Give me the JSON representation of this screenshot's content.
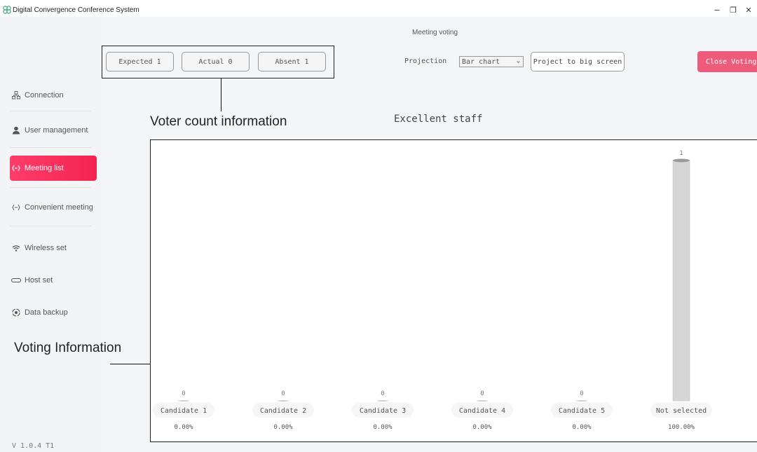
{
  "window": {
    "title": "Digital Convergence Conference System",
    "minimize": "–",
    "maximize": "❐",
    "close": "✕"
  },
  "sidebar": {
    "items": [
      {
        "label": "Connection",
        "icon": "connection-icon",
        "active": false
      },
      {
        "label": "User management",
        "icon": "user-icon",
        "active": false
      },
      {
        "label": "Meeting list",
        "icon": "meeting-list-icon",
        "active": true
      },
      {
        "label": "Convenient meeting",
        "icon": "convenient-meeting-icon",
        "active": false
      },
      {
        "label": "Wireless set",
        "icon": "wifi-icon",
        "active": false
      },
      {
        "label": "Host set",
        "icon": "host-icon",
        "active": false
      },
      {
        "label": "Data backup",
        "icon": "backup-icon",
        "active": false
      }
    ],
    "version": "V 1.0.4 T1"
  },
  "header": {
    "page_title": "Meeting voting",
    "expected": "Expected 1",
    "actual": "Actual 0",
    "absent": "Absent 1",
    "projection_label": "Projection",
    "projection_value": "Bar chart",
    "project_button": "Project to big screen",
    "close_button": "Close Voting"
  },
  "annotations": {
    "voter_count": "Voter count information",
    "voting_info": "Voting Information"
  },
  "colors": {
    "accent": "#f2244f",
    "close_button": "#ef5b7a",
    "bar": "#d6d6d6"
  },
  "chart_data": {
    "type": "bar",
    "title": "Excellent staff",
    "categories": [
      "Candidate 1",
      "Candidate 2",
      "Candidate 3",
      "Candidate 4",
      "Candidate 5",
      "Not selected"
    ],
    "values": [
      0,
      0,
      0,
      0,
      0,
      1
    ],
    "percentages": [
      "0.00%",
      "0.00%",
      "0.00%",
      "0.00%",
      "0.00%",
      "100.00%"
    ],
    "ylim": [
      0,
      1
    ]
  }
}
